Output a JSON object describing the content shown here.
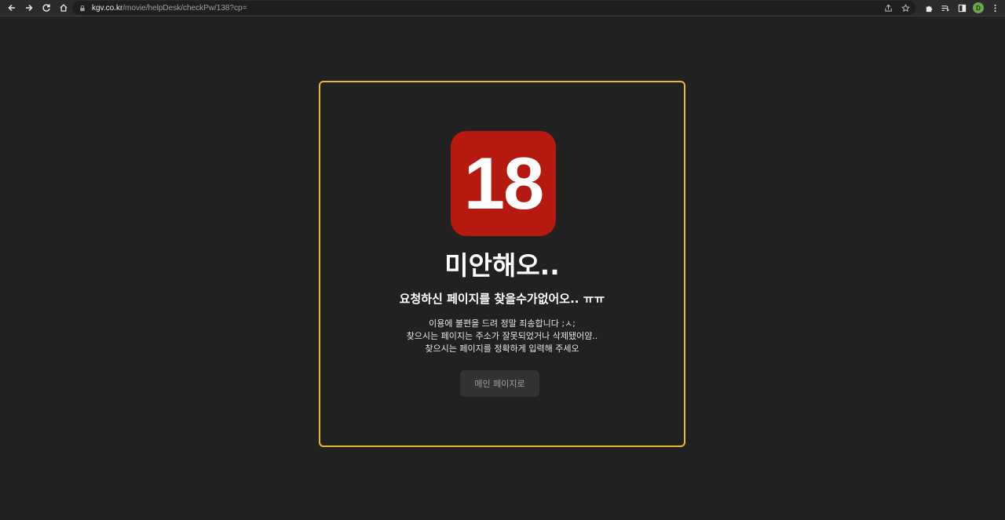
{
  "browser": {
    "url_host": "kgv.co.kr",
    "url_path": "/movie/helpDesk/checkPw/138?cp=",
    "avatar_letter": "D",
    "icons": {
      "back": "arrow-left-icon",
      "forward": "arrow-right-icon",
      "reload": "reload-icon",
      "home": "home-icon",
      "lock": "lock-icon",
      "share": "share-icon",
      "bookmark": "star-icon",
      "extensions": "puzzle-icon",
      "reading_list": "reading-list-icon",
      "side_panel": "side-panel-icon",
      "menu": "kebab-menu-icon"
    }
  },
  "error": {
    "badge_text": "18",
    "title": "미안해오..",
    "subtitle": "요청하신 페이지를 찾을수가없어오.. ㅠㅠ",
    "lines": [
      "이용에 불편을 드려 정말 죄송합니다 ;ㅅ;",
      "찾으시는 페이지는 주소가 잘못되었거나 삭제됐어얌..",
      "찾으시는 페이지를 정확하게 입력해 주세오"
    ],
    "button_label": "메인 페이지로"
  },
  "colors": {
    "background": "#212121",
    "card_border": "#e8b92f",
    "badge": "#b5190f",
    "button": "#333333"
  }
}
